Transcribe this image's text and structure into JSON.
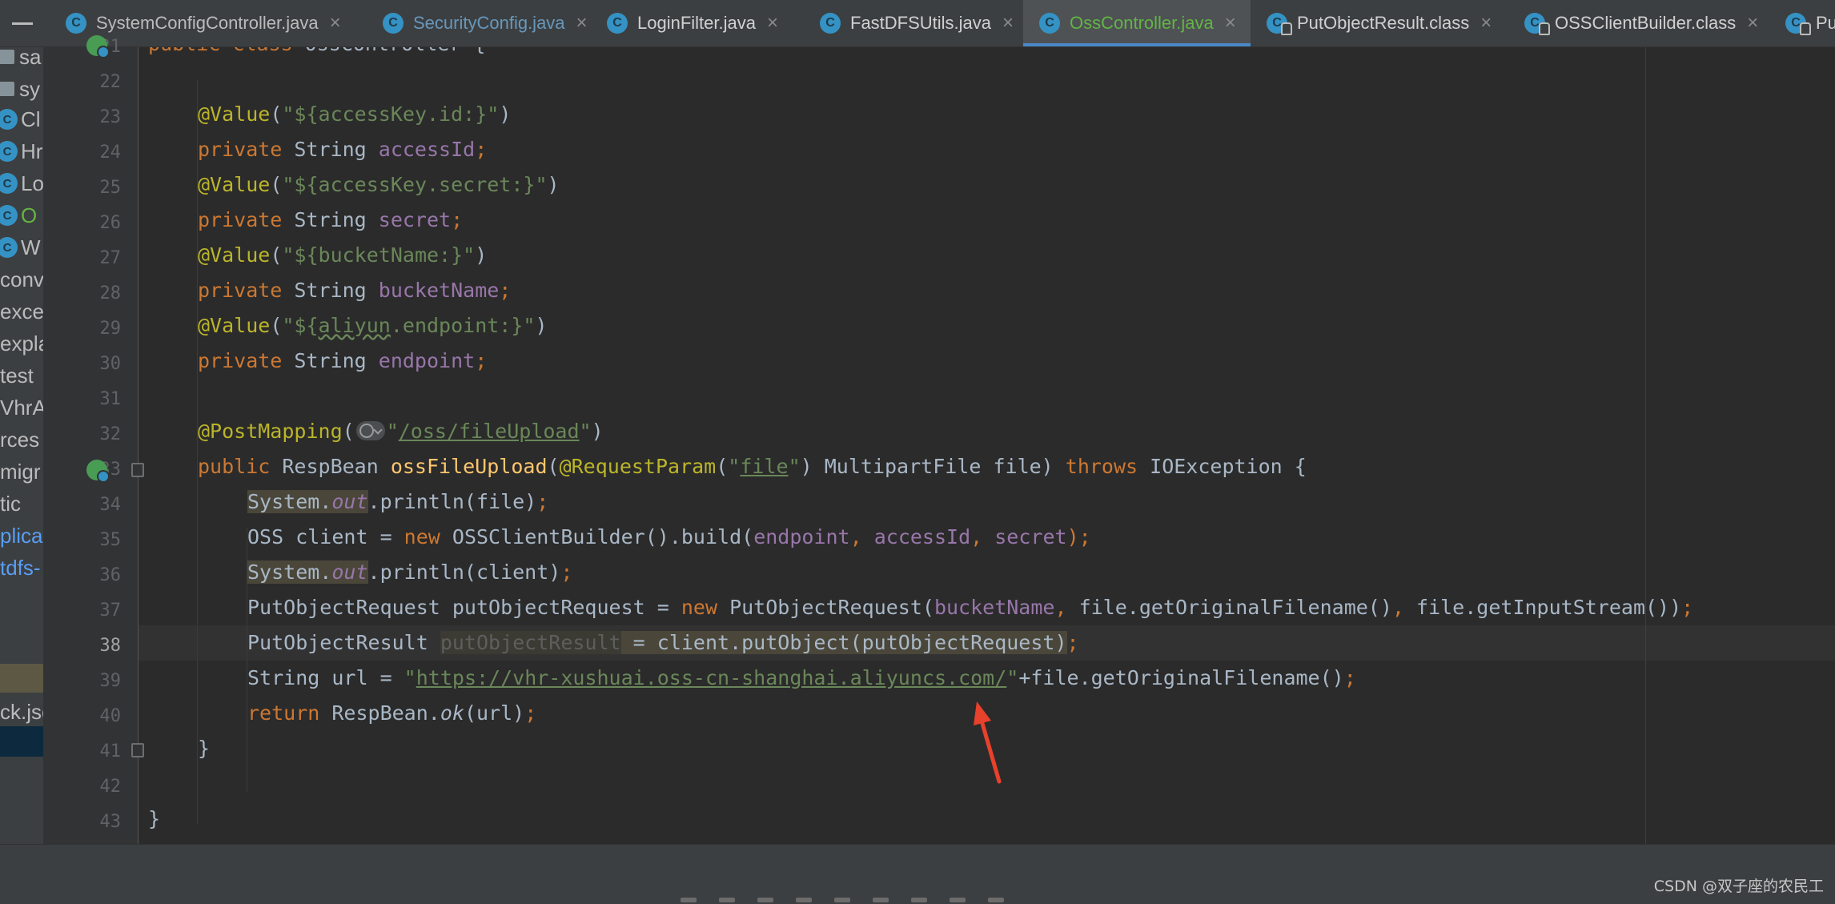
{
  "tabs": [
    {
      "label": "SystemConfigController.java",
      "color": "default"
    },
    {
      "label": "SecurityConfig.java",
      "color": "blue"
    },
    {
      "label": "LoginFilter.java",
      "color": "light"
    },
    {
      "label": "FastDFSUtils.java",
      "color": "light"
    },
    {
      "label": "OssController.java",
      "color": "green",
      "active": true
    },
    {
      "label": "PutObjectResult.class",
      "color": "light"
    },
    {
      "label": "OSSClientBuilder.class",
      "color": "light"
    },
    {
      "label": "Pu",
      "color": "light"
    }
  ],
  "tab_icon_letter": "C",
  "tab_close_glyph": "×",
  "project_items": [
    {
      "label": "sa",
      "icon": "folder-icon"
    },
    {
      "label": "sy",
      "icon": "folder-icon"
    },
    {
      "label": "Cl",
      "icon": "class-icon"
    },
    {
      "label": "Hr",
      "icon": "class-icon"
    },
    {
      "label": "Lo",
      "icon": "class-icon"
    },
    {
      "label": "O",
      "icon": "class-icon",
      "color": "green"
    },
    {
      "label": "W",
      "icon": "class-icon"
    },
    {
      "label": "conv",
      "icon": ""
    },
    {
      "label": "exce",
      "icon": ""
    },
    {
      "label": "expla",
      "icon": ""
    },
    {
      "label": "test",
      "icon": ""
    },
    {
      "label": "VhrA",
      "icon": ""
    },
    {
      "label": "rces",
      "icon": ""
    },
    {
      "label": "migr",
      "icon": ""
    },
    {
      "label": "tic",
      "icon": ""
    },
    {
      "label": "plicat",
      "icon": "",
      "color": "blue"
    },
    {
      "label": "tdfs-",
      "icon": "",
      "color": "blue"
    },
    {
      "label": "ck.jso",
      "icon": ""
    }
  ],
  "line_numbers": [
    "21",
    "22",
    "23",
    "24",
    "25",
    "26",
    "27",
    "28",
    "29",
    "30",
    "31",
    "32",
    "33",
    "34",
    "35",
    "36",
    "37",
    "38",
    "39",
    "40",
    "41",
    "42",
    "43"
  ],
  "current_line": "38",
  "code": {
    "l21a": "public class ",
    "l21b": "OssController {",
    "l23a": "@Value",
    "l23b": "(",
    "l23c": "\"${accessKey.id:}\"",
    "l23d": ")",
    "l24a": "private ",
    "l24b": "String ",
    "l24c": "accessId",
    "l24d": ";",
    "l25a": "@Value",
    "l25b": "(",
    "l25c": "\"${accessKey.secret:}\"",
    "l25d": ")",
    "l26a": "private ",
    "l26b": "String ",
    "l26c": "secret",
    "l26d": ";",
    "l27a": "@Value",
    "l27b": "(",
    "l27c": "\"${bucketName:}\"",
    "l27d": ")",
    "l28a": "private ",
    "l28b": "String ",
    "l28c": "bucketName",
    "l28d": ";",
    "l29a": "@Value",
    "l29b": "(",
    "l29c1": "\"${",
    "l29c2": "aliyun",
    "l29c3": ".endpoint:}\"",
    "l29d": ")",
    "l30a": "private ",
    "l30b": "String ",
    "l30c": "endpoint",
    "l30d": ";",
    "l32a": "@PostMapping",
    "l32b": "(",
    "l32c1": "\"",
    "l32c2": "/oss/fileUpload",
    "l32c3": "\"",
    "l32d": ")",
    "l33a": "public ",
    "l33b": "RespBean ",
    "l33c": "ossFileUpload",
    "l33d": "(",
    "l33e": "@RequestParam",
    "l33f": "(",
    "l33g1": "\"",
    "l33g2": "file",
    "l33g3": "\"",
    "l33h": ") MultipartFile file) ",
    "l33i": "throws ",
    "l33j": "IOException {",
    "l34a": "System.",
    "l34b": "out",
    "l34c": ".println(file)",
    "l34d": ";",
    "l35a": "OSS client = ",
    "l35b": "new ",
    "l35c": "OSSClientBuilder().build(",
    "l35d": "endpoint",
    "l35e": ", ",
    "l35f": "accessId",
    "l35g": ", ",
    "l35h": "secret",
    "l35i": ");",
    "l36a": "System.",
    "l36b": "out",
    "l36c": ".println(client)",
    "l36d": ";",
    "l37a": "PutObjectRequest putObjectRequest = ",
    "l37b": "new ",
    "l37c": "PutObjectRequest(",
    "l37d": "bucketName",
    "l37e": ", ",
    "l37f": "file.getOriginalFilename()",
    "l37g": ", ",
    "l37h": "file.getInputStream())",
    "l37i": ";",
    "l38a": "PutObjectResult ",
    "l38b": "putObjectResult",
    "l38c": " = client.putObject(putObjectRequest)",
    "l38d": ";",
    "l39a": "String url = ",
    "l39b1": "\"",
    "l39b2": "https://vhr-xushuai.oss-cn-shanghai.aliyuncs.com/",
    "l39b3": "\"",
    "l39c": "+file.getOriginalFilename()",
    "l39d": ";",
    "l40a": "return ",
    "l40b": "RespBean.",
    "l40c": "ok",
    "l40d": "(url)",
    "l40e": ";",
    "l41": "}",
    "l43": "}"
  },
  "colors": {
    "keyword": "#cc7832",
    "annotation": "#bbb529",
    "string": "#6a8759",
    "field": "#9876aa",
    "method_decl": "#ffc66d",
    "plain": "#a9b7c6",
    "arrow": "#e8412c"
  },
  "icons": [
    "hamburger-icon",
    "class-icon",
    "folder-icon",
    "run-gutter-icon",
    "fold-icon",
    "lightbulb-icon",
    "web-request-icon",
    "red-arrow-annotation"
  ],
  "watermark": "CSDN @双子座的农民工"
}
